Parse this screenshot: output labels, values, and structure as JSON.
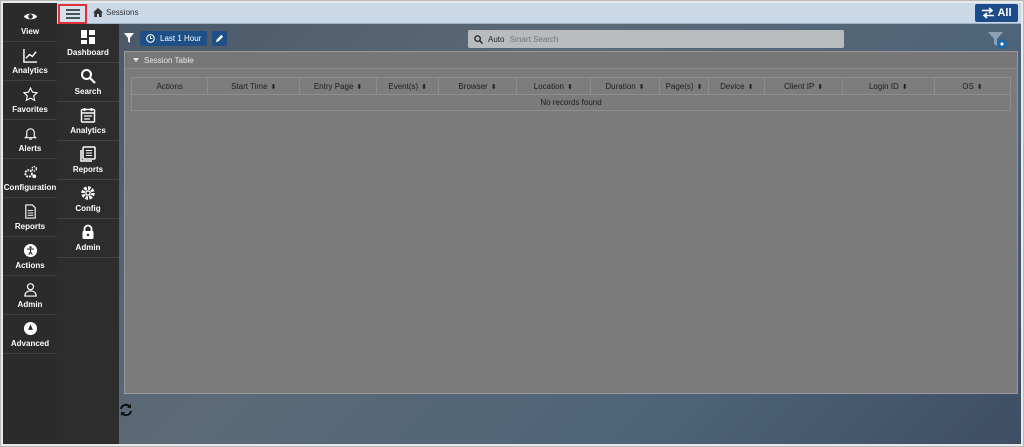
{
  "rail_primary": [
    {
      "label": "View",
      "icon": "eye-icon"
    },
    {
      "label": "Analytics",
      "icon": "line-chart-icon"
    },
    {
      "label": "Favorites",
      "icon": "star-icon"
    },
    {
      "label": "Alerts",
      "icon": "bell-icon"
    },
    {
      "label": "Configuration",
      "icon": "gears-icon"
    },
    {
      "label": "Reports",
      "icon": "document-icon"
    },
    {
      "label": "Actions",
      "icon": "accessibility-icon"
    },
    {
      "label": "Admin",
      "icon": "user-icon"
    },
    {
      "label": "Advanced",
      "icon": "compass-icon"
    }
  ],
  "rail_secondary": [
    {
      "label": "Dashboard",
      "icon": "dashboard-icon"
    },
    {
      "label": "Search",
      "icon": "search-icon"
    },
    {
      "label": "Analytics",
      "icon": "calendar-icon"
    },
    {
      "label": "Reports",
      "icon": "book-icon"
    },
    {
      "label": "Config",
      "icon": "gear-icon"
    },
    {
      "label": "Admin",
      "icon": "lock-icon"
    }
  ],
  "header": {
    "breadcrumb": "Sessions",
    "all_label": "All"
  },
  "toolbar": {
    "time_range": "Last 1 Hour",
    "search_mode": "Auto",
    "search_placeholder": "Smart Search"
  },
  "panel": {
    "title": "Session Table",
    "columns": [
      "Actions",
      "Start Time",
      "Entry Page",
      "Event(s)",
      "Browser",
      "Location",
      "Duration",
      "Page(s)",
      "Device",
      "Client IP",
      "Login ID",
      "OS"
    ],
    "empty_message": "No records found"
  },
  "colors": {
    "rail_bg": "#2b2b2b",
    "header_bg": "#cad8e8",
    "accent": "#1e4f86",
    "highlight": "#e0313a"
  }
}
